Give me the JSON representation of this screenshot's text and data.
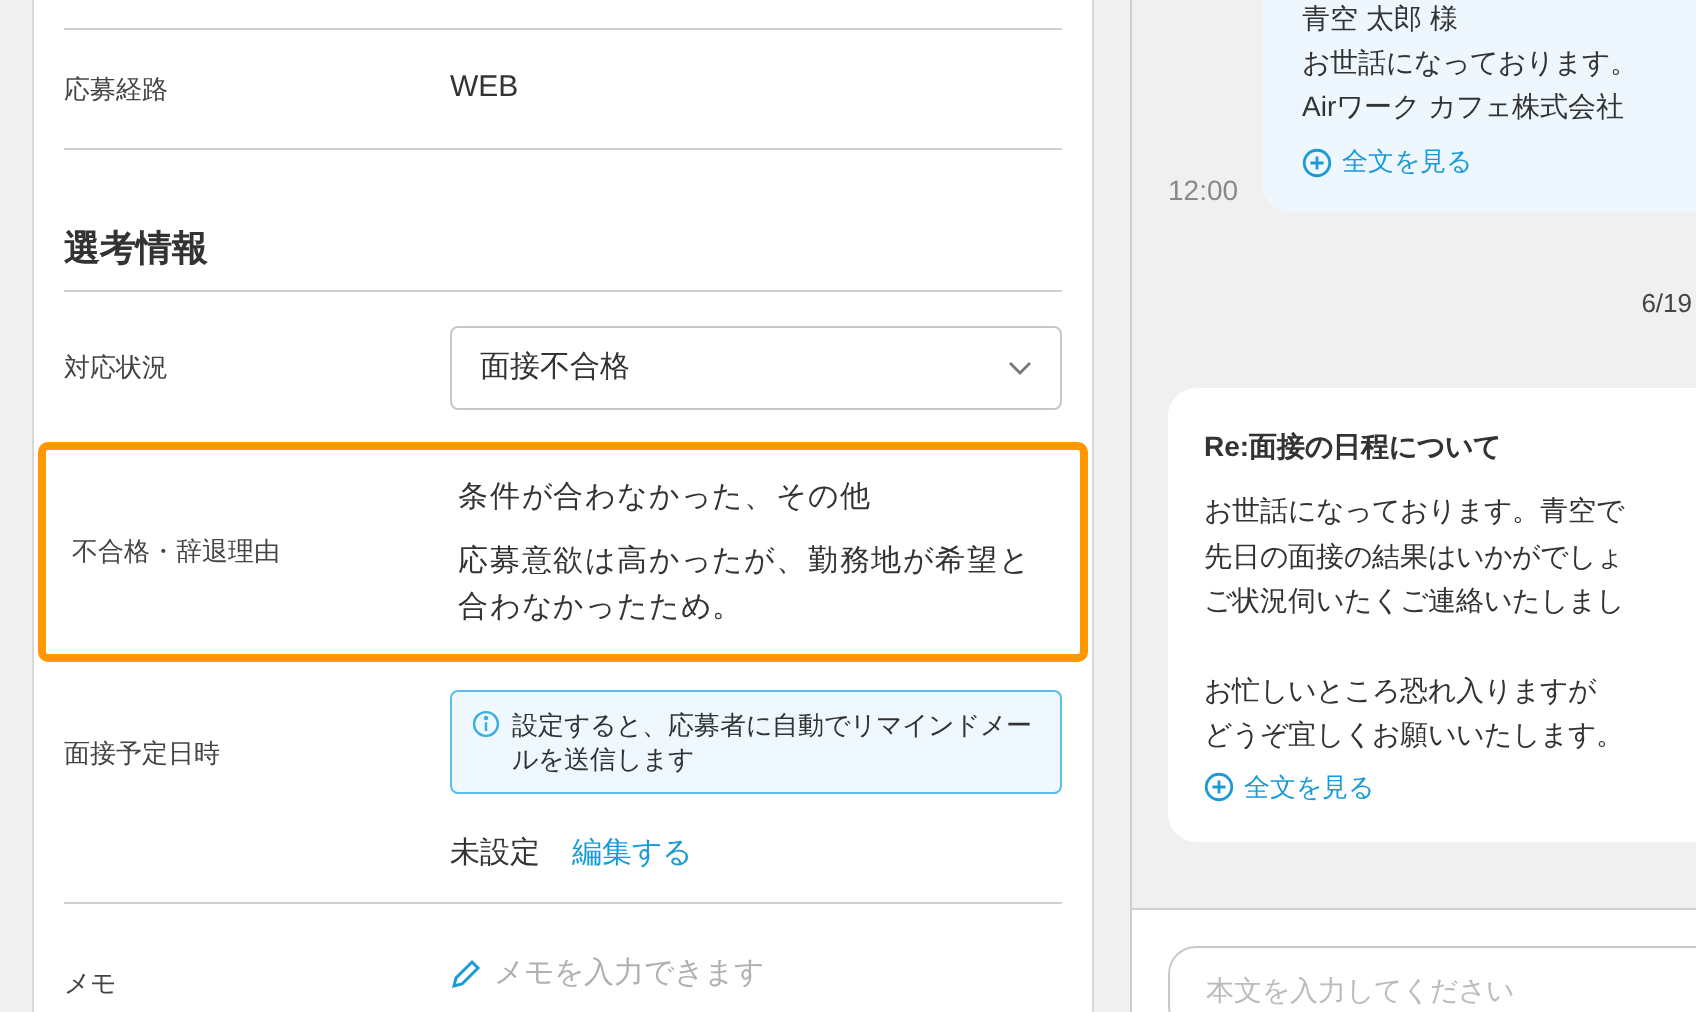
{
  "applicant_fields": [
    {
      "label": "応募経路",
      "value": "WEB"
    }
  ],
  "selection": {
    "title": "選考情報",
    "status": {
      "label": "対応状況",
      "value": "面接不合格"
    },
    "rejection_reason": {
      "label": "不合格・辞退理由",
      "category": "条件が合わなかった、その他",
      "detail": "応募意欲は高かったが、勤務地が希望と合わなかったため。",
      "highlighted": true
    },
    "interview_date": {
      "label": "面接予定日時",
      "notice": "設定すると、応募者に自動でリマインドメールを送信します",
      "value": "未設定",
      "edit_link": "編集する"
    },
    "memo": {
      "label": "メモ",
      "placeholder": "メモを入力できます"
    }
  },
  "chat": {
    "messages": [
      {
        "kind": "sent",
        "lines": [
          "青空 太郎 様",
          "お世話になっております。",
          "Airワーク カフェ株式会社"
        ],
        "more": "全文を見る",
        "time": "12:00"
      },
      {
        "kind": "date",
        "text": "6/19"
      },
      {
        "kind": "received",
        "subject": "Re:面接の日程について",
        "paragraphs": [
          [
            "お世話になっております。青空で",
            "先日の面接の結果はいかがでしょ",
            "ご状況伺いたくご連絡いたしまし"
          ],
          [
            "お忙しいところ恐れ入りますが",
            "どうぞ宜しくお願いいたします。"
          ]
        ],
        "more": "全文を見る"
      }
    ],
    "composer": {
      "placeholder": "本文を入力してください"
    }
  }
}
